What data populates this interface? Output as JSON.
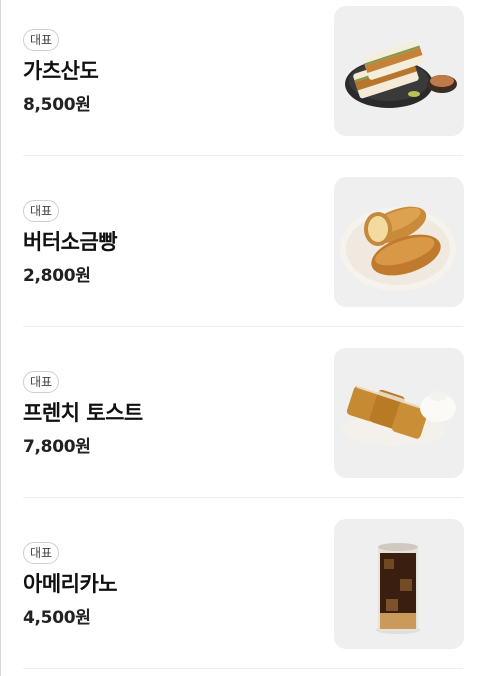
{
  "menu": {
    "items": [
      {
        "badge": "대표",
        "name": "가츠산도",
        "price": "8,500원",
        "image": "katsu-sando-image"
      },
      {
        "badge": "대표",
        "name": "버터소금빵",
        "price": "2,800원",
        "image": "salt-butter-bread-image"
      },
      {
        "badge": "대표",
        "name": "프렌치 토스트",
        "price": "7,800원",
        "image": "french-toast-image"
      },
      {
        "badge": "대표",
        "name": "아메리카노",
        "price": "4,500원",
        "image": "iced-americano-image"
      }
    ]
  },
  "colors": {
    "thumb_bg": "#efefef",
    "divider": "#eeeeee",
    "text": "#111111"
  }
}
